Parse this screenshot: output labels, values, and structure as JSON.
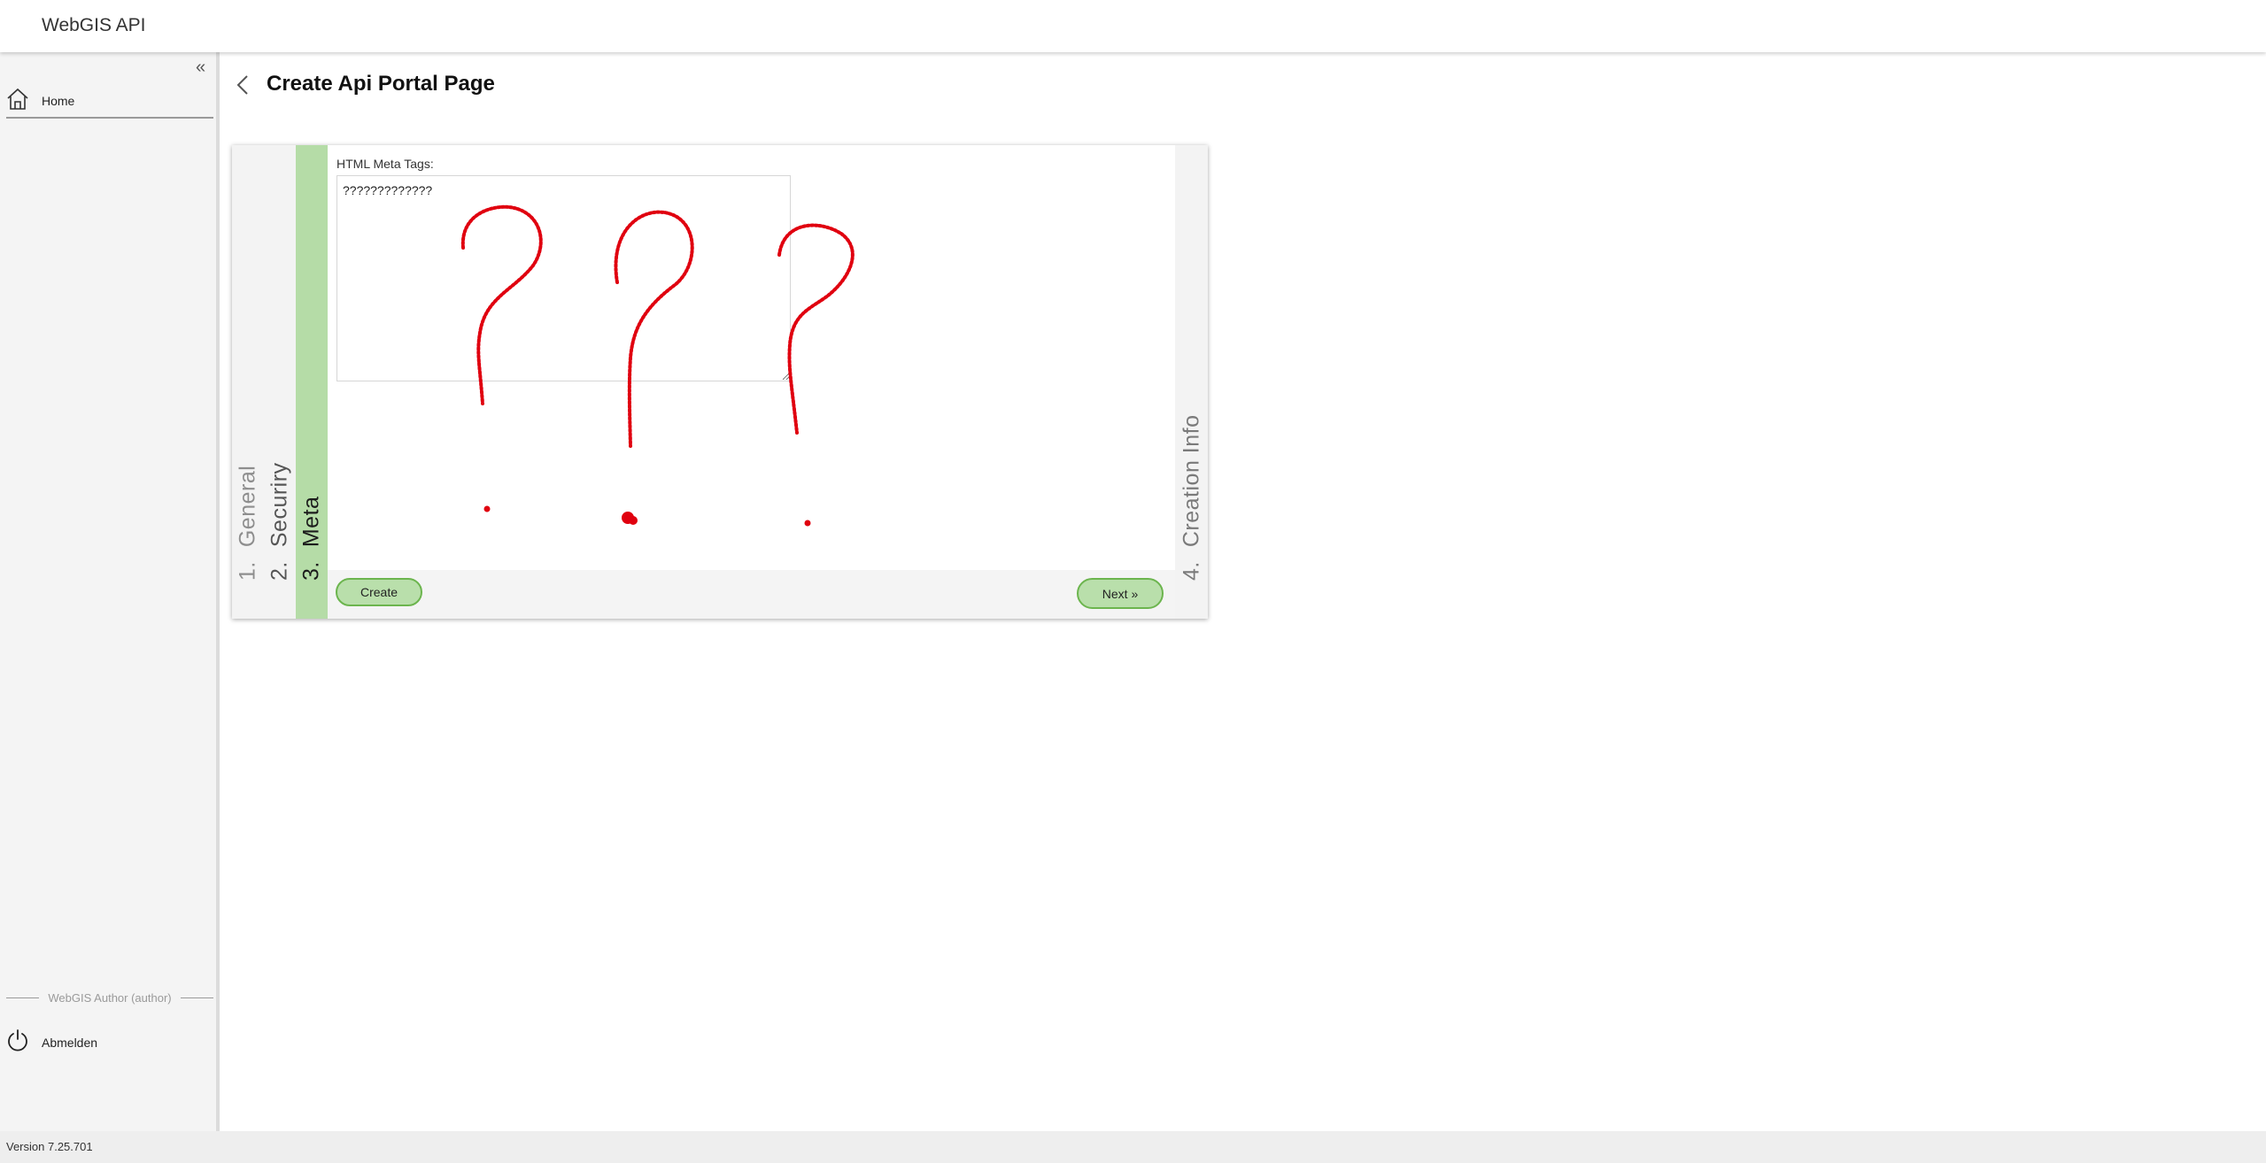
{
  "app": {
    "title": "WebGIS API"
  },
  "sidebar": {
    "collapse_label": "«",
    "items": [
      {
        "label": "Home",
        "icon": "home-icon"
      }
    ],
    "user_label": "WebGIS Author (author)",
    "logout": {
      "label": "Abmelden",
      "icon": "power-icon"
    }
  },
  "footer": {
    "version": "Version 7.25.701"
  },
  "page": {
    "title": "Create Api Portal Page",
    "back_icon": "chevron-left-icon"
  },
  "wizard": {
    "steps": [
      {
        "number": "1.",
        "label": "General",
        "active": false
      },
      {
        "number": "2.",
        "label": "Securiry",
        "active": false
      },
      {
        "number": "3.",
        "label": "Meta",
        "active": true
      },
      {
        "number": "4.",
        "label": "Creation Info",
        "active": false
      }
    ],
    "meta": {
      "label": "HTML Meta Tags:",
      "value": "?????????????"
    },
    "buttons": {
      "create": "Create",
      "next": "Next »"
    }
  },
  "colors": {
    "active_step": "#b5dca7",
    "button_fill": "#b9dfab",
    "button_border": "#6cb54e",
    "doodle": "#e0000f",
    "sidebar_bg": "#f4f4f4"
  }
}
